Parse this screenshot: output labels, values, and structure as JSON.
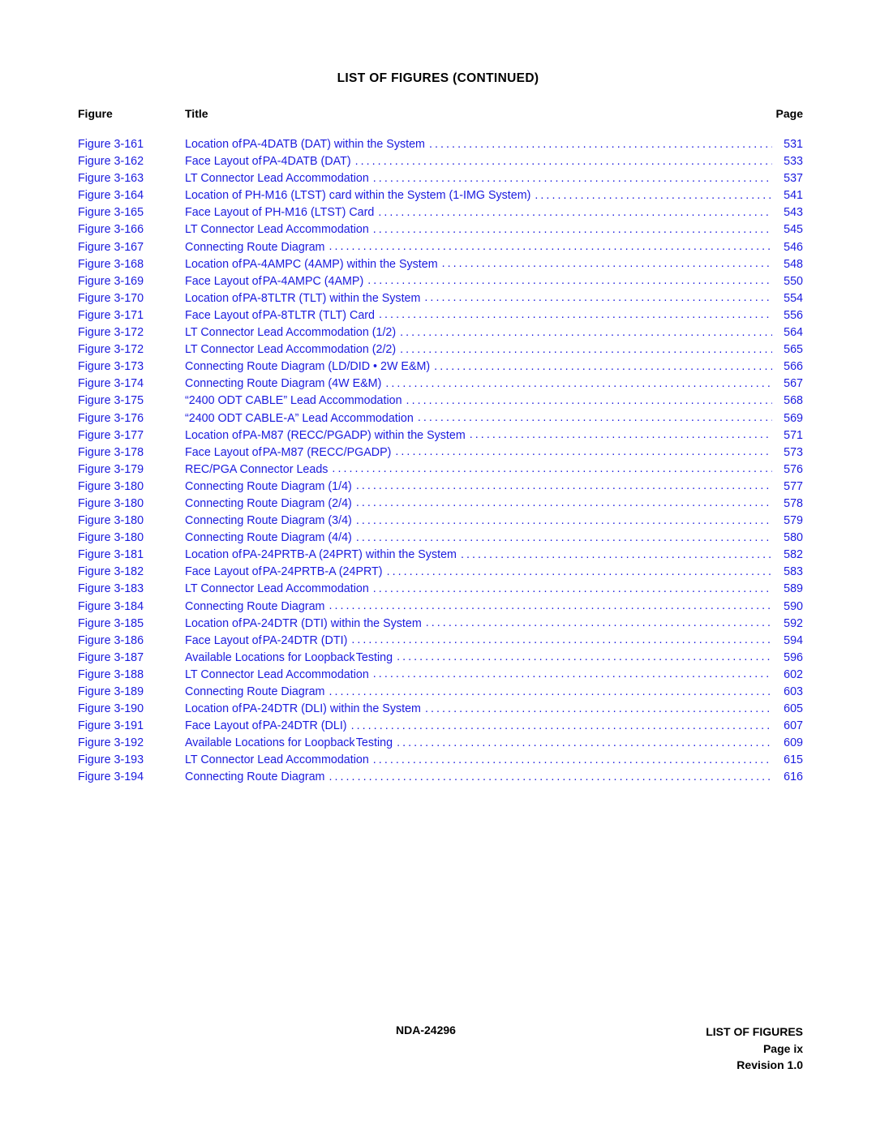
{
  "heading": "LIST OF FIGURES  (CONTINUED)",
  "columns": {
    "figure": "Figure",
    "title": "Title",
    "page": "Page"
  },
  "entries": [
    {
      "figure": "Figure 3-161",
      "title": "Location of PA-4DATB (DAT) within the System",
      "page": "531"
    },
    {
      "figure": "Figure 3-162",
      "title": "Face Layout of PA-4DATB (DAT)",
      "page": "533"
    },
    {
      "figure": "Figure 3-163",
      "title": "LT Connector Lead Accommodation",
      "page": "537"
    },
    {
      "figure": "Figure 3-164",
      "title": "Location of PH-M16 (LTST) card within the System (1-IMG System)",
      "page": "541"
    },
    {
      "figure": "Figure 3-165",
      "title": "Face Layout of PH-M16 (LTST) Card",
      "page": "543"
    },
    {
      "figure": "Figure 3-166",
      "title": "LT Connector Lead Accommodation",
      "page": "545"
    },
    {
      "figure": "Figure 3-167",
      "title": "Connecting Route Diagram",
      "page": "546"
    },
    {
      "figure": "Figure 3-168",
      "title": "Location of PA-4AMPC (4AMP) within the System",
      "page": "548"
    },
    {
      "figure": "Figure 3-169",
      "title": "Face Layout of PA-4AMPC (4AMP)",
      "page": "550"
    },
    {
      "figure": "Figure 3-170",
      "title": "Location of PA-8TLTR (TLT) within the System",
      "page": "554"
    },
    {
      "figure": "Figure 3-171",
      "title": "Face Layout of PA-8TLTR (TLT) Card",
      "page": "556"
    },
    {
      "figure": "Figure 3-172",
      "title": "LT Connector Lead Accommodation (1/2)",
      "page": "564"
    },
    {
      "figure": "Figure 3-172",
      "title": "LT Connector Lead Accommodation (2/2)",
      "page": "565"
    },
    {
      "figure": "Figure 3-173",
      "title": "Connecting Route Diagram (LD/DID • 2W E&M)",
      "page": "566"
    },
    {
      "figure": "Figure 3-174",
      "title": "Connecting Route Diagram (4W E&M)",
      "page": "567"
    },
    {
      "figure": "Figure 3-175",
      "title": "“2400 ODT CABLE” Lead Accommodation",
      "page": "568"
    },
    {
      "figure": "Figure 3-176",
      "title": "“2400 ODT CABLE-A” Lead Accommodation",
      "page": "569"
    },
    {
      "figure": "Figure 3-177",
      "title": "Location of PA-M87 (RECC/PGADP) within the System",
      "page": "571"
    },
    {
      "figure": "Figure 3-178",
      "title": "Face Layout of PA-M87 (RECC/PGADP)",
      "page": "573"
    },
    {
      "figure": "Figure 3-179",
      "title": "REC/PGA Connector Leads",
      "page": "576"
    },
    {
      "figure": "Figure 3-180",
      "title": "Connecting Route Diagram (1/4)",
      "page": "577"
    },
    {
      "figure": "Figure 3-180",
      "title": "Connecting Route Diagram (2/4)",
      "page": "578"
    },
    {
      "figure": "Figure 3-180",
      "title": "Connecting Route Diagram (3/4)",
      "page": "579"
    },
    {
      "figure": "Figure 3-180",
      "title": "Connecting Route Diagram (4/4)",
      "page": "580"
    },
    {
      "figure": "Figure 3-181",
      "title": "Location of PA-24PRTB-A (24PRT) within the System",
      "page": "582"
    },
    {
      "figure": "Figure 3-182",
      "title": "Face Layout of PA-24PRTB-A (24PRT)",
      "page": "583"
    },
    {
      "figure": "Figure 3-183",
      "title": "LT Connector Lead Accommodation",
      "page": "589"
    },
    {
      "figure": "Figure 3-184",
      "title": "Connecting Route Diagram",
      "page": "590"
    },
    {
      "figure": "Figure 3-185",
      "title": "Location of PA-24DTR (DTI) within the System",
      "page": "592"
    },
    {
      "figure": "Figure 3-186",
      "title": "Face Layout of PA-24DTR (DTI)",
      "page": "594"
    },
    {
      "figure": "Figure 3-187",
      "title": "Available Locations for Loopback Testing",
      "page": "596"
    },
    {
      "figure": "Figure 3-188",
      "title": "LT Connector Lead Accommodation",
      "page": "602"
    },
    {
      "figure": "Figure 3-189",
      "title": "Connecting Route Diagram",
      "page": "603"
    },
    {
      "figure": "Figure 3-190",
      "title": "Location of PA-24DTR (DLI) within the System",
      "page": "605"
    },
    {
      "figure": "Figure 3-191",
      "title": "Face Layout of PA-24DTR (DLI)",
      "page": "607"
    },
    {
      "figure": "Figure 3-192",
      "title": "Available Locations for Loopback Testing",
      "page": "609"
    },
    {
      "figure": "Figure 3-193",
      "title": "LT Connector Lead Accommodation",
      "page": "615"
    },
    {
      "figure": "Figure 3-194",
      "title": "Connecting Route Diagram",
      "page": "616"
    }
  ],
  "footer": {
    "document_id": "NDA-24296",
    "section": "LIST OF FIGURES",
    "page_number": "Page ix",
    "revision": "Revision 1.0"
  },
  "colors": {
    "entry_blue": "#1b1bdf",
    "text_black": "#000000",
    "page_background": "#ffffff"
  }
}
